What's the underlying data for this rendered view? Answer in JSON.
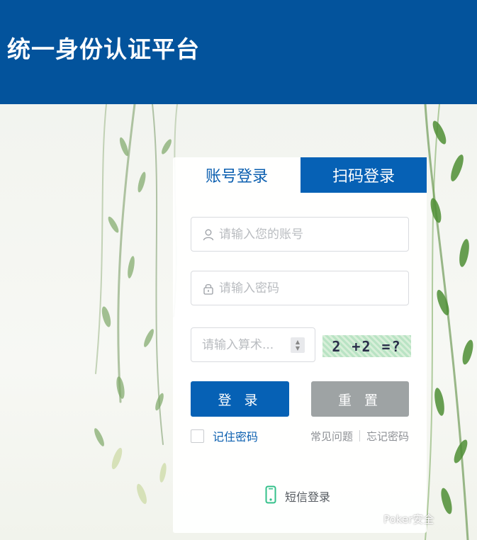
{
  "header": {
    "title": "统一身份认证平台"
  },
  "tabs": [
    {
      "label": "账号登录",
      "active": true
    },
    {
      "label": "扫码登录",
      "active": false
    }
  ],
  "form": {
    "username_placeholder": "请输入您的账号",
    "password_placeholder": "请输入密码",
    "captcha_placeholder": "请输入算术...",
    "captcha_text": "2 +2 =?"
  },
  "buttons": {
    "login": "登 录",
    "reset": "重 置"
  },
  "remember_label": "记住密码",
  "links": {
    "faq": "常见问题",
    "forgot": "忘记密码"
  },
  "sms_login": "短信登录",
  "watermark": "Poker安全",
  "colors": {
    "header_bg": "#03539c",
    "accent": "#0661b5",
    "reset_bg": "#9ea3a4"
  },
  "icons": {
    "user": "user-icon",
    "lock": "lock-icon",
    "phone": "phone-icon"
  }
}
